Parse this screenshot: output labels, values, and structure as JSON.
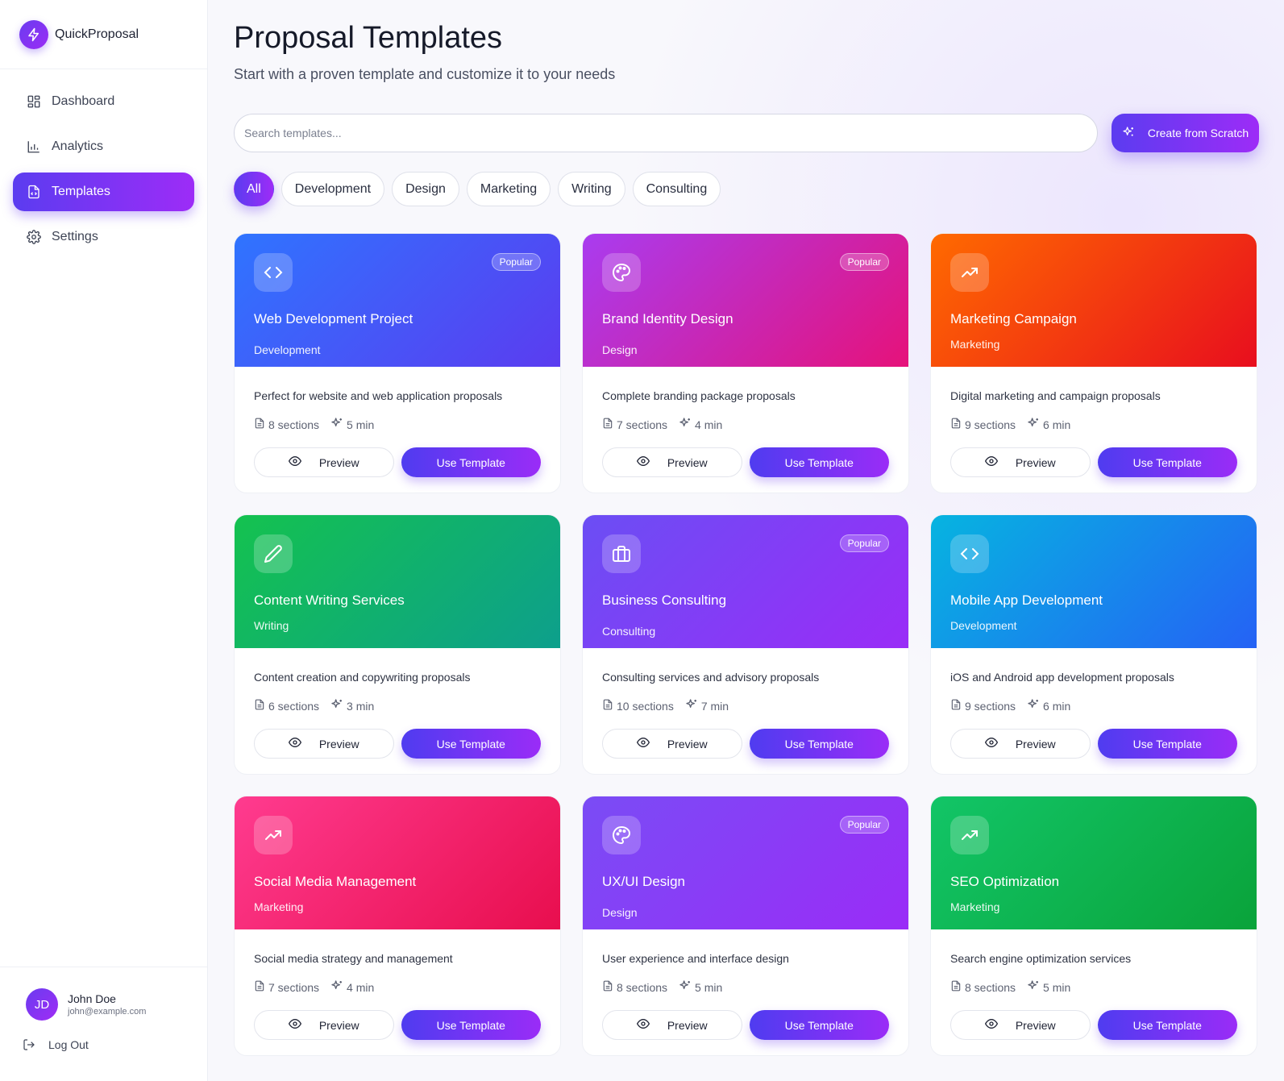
{
  "app": {
    "name": "QuickProposal"
  },
  "sidebar": {
    "items": [
      {
        "label": "Dashboard",
        "icon": "dashboard-icon"
      },
      {
        "label": "Analytics",
        "icon": "chart-icon"
      },
      {
        "label": "Templates",
        "icon": "document-icon",
        "active": true
      },
      {
        "label": "Settings",
        "icon": "gear-icon"
      }
    ]
  },
  "user": {
    "initials": "JD",
    "name": "John Doe",
    "email": "john@example.com"
  },
  "logout_label": "Log Out",
  "page": {
    "title": "Proposal Templates",
    "subtitle": "Start with a proven template and customize it to your needs"
  },
  "search": {
    "placeholder": "Search templates..."
  },
  "create_button": "Create from Scratch",
  "filters": [
    "All",
    "Development",
    "Design",
    "Marketing",
    "Writing",
    "Consulting"
  ],
  "labels": {
    "popular": "Popular",
    "preview": "Preview",
    "use": "Use Template"
  },
  "colors": {
    "accent_start": "#5b3cf0",
    "accent_end": "#9d2cf7"
  },
  "templates": [
    {
      "title": "Web Development Project",
      "category": "Development",
      "description": "Perfect for website and web application proposals",
      "sections": "8 sections",
      "time": "5 min",
      "popular": true,
      "icon": "code-icon"
    },
    {
      "title": "Brand Identity Design",
      "category": "Design",
      "description": "Complete branding package proposals",
      "sections": "7 sections",
      "time": "4 min",
      "popular": true,
      "icon": "palette-icon"
    },
    {
      "title": "Marketing Campaign",
      "category": "Marketing",
      "description": "Digital marketing and campaign proposals",
      "sections": "9 sections",
      "time": "6 min",
      "popular": false,
      "icon": "trending-up-icon"
    },
    {
      "title": "Content Writing Services",
      "category": "Writing",
      "description": "Content creation and copywriting proposals",
      "sections": "6 sections",
      "time": "3 min",
      "popular": false,
      "icon": "pencil-icon"
    },
    {
      "title": "Business Consulting",
      "category": "Consulting",
      "description": "Consulting services and advisory proposals",
      "sections": "10 sections",
      "time": "7 min",
      "popular": true,
      "icon": "briefcase-icon"
    },
    {
      "title": "Mobile App Development",
      "category": "Development",
      "description": "iOS and Android app development proposals",
      "sections": "9 sections",
      "time": "6 min",
      "popular": false,
      "icon": "code-icon"
    },
    {
      "title": "Social Media Management",
      "category": "Marketing",
      "description": "Social media strategy and management",
      "sections": "7 sections",
      "time": "4 min",
      "popular": false,
      "icon": "trending-up-icon"
    },
    {
      "title": "UX/UI Design",
      "category": "Design",
      "description": "User experience and interface design",
      "sections": "8 sections",
      "time": "5 min",
      "popular": true,
      "icon": "palette-icon"
    },
    {
      "title": "SEO Optimization",
      "category": "Marketing",
      "description": "Search engine optimization services",
      "sections": "8 sections",
      "time": "5 min",
      "popular": false,
      "icon": "trending-up-icon"
    }
  ]
}
